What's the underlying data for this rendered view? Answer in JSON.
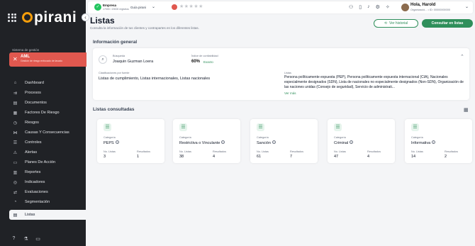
{
  "app": {
    "logo_text": "pirani"
  },
  "sidebar": {
    "management_label": "Sistema de gestión",
    "management": {
      "title": "AML",
      "subtitle": "Gestión de riesgo enfocado de lavado"
    },
    "items": [
      {
        "label": "Dashboard",
        "icon": "dashboard-icon",
        "glyph": "⌂"
      },
      {
        "label": "Procesos",
        "icon": "processes-icon",
        "glyph": "⇉"
      },
      {
        "label": "Documentos",
        "icon": "documents-icon",
        "glyph": "▤"
      },
      {
        "label": "Factores De Riesgo",
        "icon": "risk-factors-icon",
        "glyph": "▦"
      },
      {
        "label": "Riesgos",
        "icon": "risks-icon",
        "glyph": "◷"
      },
      {
        "label": "Causas Y Consecuencias",
        "icon": "causes-icon",
        "glyph": "⋈"
      },
      {
        "label": "Controles",
        "icon": "controls-icon",
        "glyph": "☰"
      },
      {
        "label": "Alertas",
        "icon": "alerts-icon",
        "glyph": "⚠"
      },
      {
        "label": "Planes De Acción",
        "icon": "action-plans-icon",
        "glyph": "▭"
      },
      {
        "label": "Reportes",
        "icon": "reports-icon",
        "glyph": "▥"
      },
      {
        "label": "Indicadores",
        "icon": "indicators-icon",
        "glyph": "◎"
      },
      {
        "label": "Evaluaciones",
        "icon": "evaluations-icon",
        "glyph": "⇄"
      },
      {
        "label": "Segmentación",
        "icon": "segmentation-icon",
        "glyph": "◔"
      },
      {
        "label": "Listas",
        "icon": "lists-icon",
        "glyph": "▤",
        "active": true
      }
    ]
  },
  "topbar": {
    "company_name": "Empresa",
    "company_sub": "17000 / 20000 registros",
    "guide_label": "Guía pirani",
    "stars": "★★★★★",
    "user_hello": "Hola, Harold",
    "user_org": "Organizació... • ID: 00000000000"
  },
  "page": {
    "title": "Listas",
    "subtitle": "Consulta la información de tus clientes y contrapartes en los diferentes listas.",
    "history_button": "Ver historial",
    "query_button": "Consultar en listas"
  },
  "general": {
    "section_title": "Información general",
    "search_label": "Búsqueda",
    "search_value": "Joaquin Guzman Loera",
    "confidence_label": "Índice de confiabilidad",
    "confidence_value": "60%",
    "confidence_grade": "Exacto",
    "classif_label": "Clasificaciones por fuente",
    "classif_value": "Listas de cumplimiento, Listas internacionales, Listas nacionales",
    "lists_label": "Listas",
    "lists_value": "Persona políticamente expuesta (PEP), Persona políticamente expuesta internacional (CIA), Nacionales especialmente designados (SDN), Lista de nacionales no especialmente designados (Non-SDN), Organización de las naciones unidas (Consejo de seguridad), Servicio de administrati...",
    "see_more": "Ver más"
  },
  "consulted": {
    "section_title": "Listas consultadas",
    "category_label": "Categoría",
    "count_label": "No. Listas",
    "results_label": "Resultados",
    "cards": [
      {
        "category": "PEPS",
        "lists": "3",
        "results": "1"
      },
      {
        "category": "Restrictiva o Vinculante",
        "lists": "38",
        "results": "4"
      },
      {
        "category": "Sanción",
        "lists": "61",
        "results": "7"
      },
      {
        "category": "Criminal",
        "lists": "47",
        "results": "4"
      },
      {
        "category": "Informativa",
        "lists": "14",
        "results": "2"
      }
    ]
  },
  "colors": {
    "sidebar": "#202226",
    "accent_green": "#2f8f5b",
    "active_red": "#e0584f",
    "logo_orange": "#f59e0b"
  }
}
